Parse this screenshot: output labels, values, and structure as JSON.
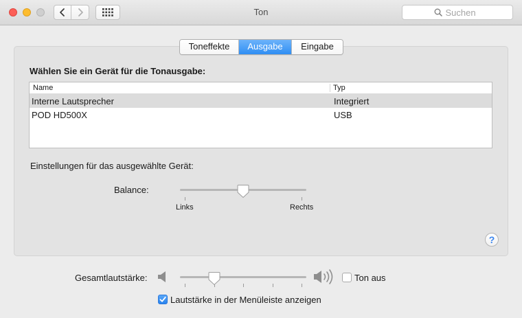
{
  "window": {
    "title": "Ton"
  },
  "search": {
    "placeholder": "Suchen"
  },
  "tabs": [
    {
      "label": "Toneffekte",
      "active": false
    },
    {
      "label": "Ausgabe",
      "active": true
    },
    {
      "label": "Eingabe",
      "active": false
    }
  ],
  "output": {
    "heading": "Wählen Sie ein Gerät für die Tonausgabe:",
    "columns": {
      "name": "Name",
      "type": "Typ"
    },
    "devices": [
      {
        "name": "Interne Lautsprecher",
        "type": "Integriert",
        "selected": true
      },
      {
        "name": "POD HD500X",
        "type": "USB",
        "selected": false
      }
    ],
    "settings_label": "Einstellungen für das ausgewählte Gerät:",
    "balance": {
      "label": "Balance:",
      "left_label": "Links",
      "right_label": "Rechts",
      "value": 0.5
    }
  },
  "help": {
    "label": "?"
  },
  "volume": {
    "label": "Gesamtlautstärke:",
    "value": 0.27,
    "mute_label": "Ton aus",
    "mute_checked": false,
    "menubar_label": "Lautstärke in der Menüleiste anzeigen",
    "menubar_checked": true
  },
  "colors": {
    "accent": "#2f8ef3",
    "selected_row": "#dcdcdc",
    "panel": "#e3e3e3"
  }
}
